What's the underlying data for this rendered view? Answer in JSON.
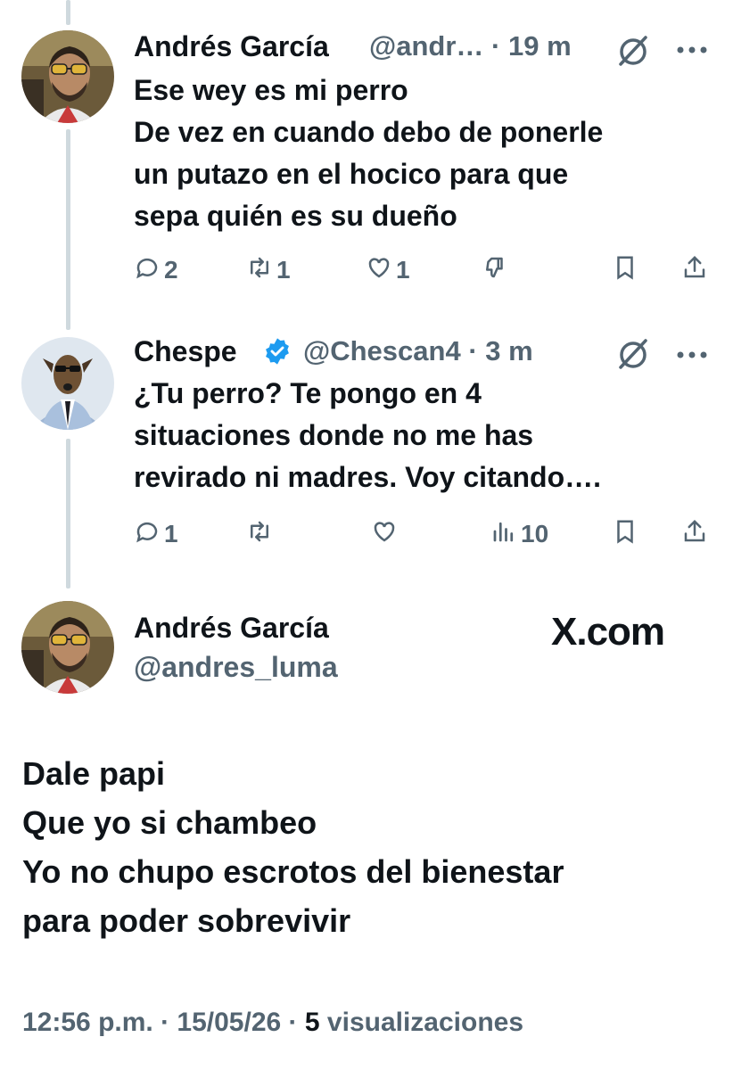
{
  "tweets": [
    {
      "name": "Andrés García",
      "handle": "@andr…",
      "time": "19 m",
      "text": "Ese wey es mi perro\nDe vez en cuando debo de ponerle\nun putazo en el hocico para que\nsepa quién es su dueño",
      "replies": "2",
      "retweets": "1",
      "likes": "1"
    },
    {
      "name": "Chespe",
      "handle": "@Chescan4",
      "time": "3 m",
      "verified": true,
      "text": "¿Tu perro? Te pongo en 4\nsituaciones donde no me has\nrevirado ni madres. Voy citando….",
      "replies": "1",
      "views": "10"
    }
  ],
  "main": {
    "name": "Andrés García",
    "handle": "@andres_luma",
    "brand": "X.com",
    "text": "Dale papi\nQue yo si chambeo\nYo no chupo escrotos del bienestar\npara poder sobrevivir",
    "footer": {
      "time": "12:56 p.m.",
      "sep1": "·",
      "date": "15/05/26",
      "sep2": "·",
      "views_count": "5",
      "views_label": "visualizaciones"
    }
  },
  "separator": "·",
  "colors": {
    "text": "#0f1419",
    "muted": "#536471",
    "verified": "#1d9bf0",
    "thread": "#cfd9de"
  },
  "icons": [
    "grok-slash-icon",
    "more-icon",
    "reply-icon",
    "retweet-icon",
    "like-icon",
    "dislike-icon",
    "views-icon",
    "bookmark-icon",
    "share-icon",
    "verified-icon"
  ]
}
